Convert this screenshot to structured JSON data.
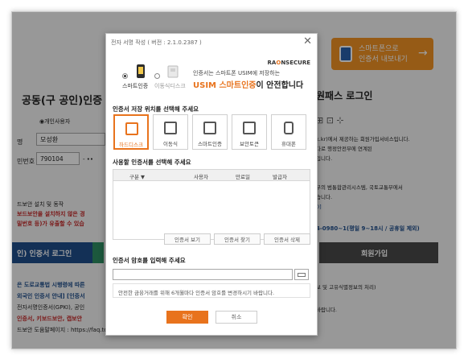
{
  "background": {
    "left": {
      "title": "공동(구 공인)인증",
      "radio_individual": "◉개인사용자",
      "name_label": "명",
      "name_value": "모성환",
      "id_label": "민번호",
      "id_value": "790104",
      "id_dash": "- ••",
      "security_note": "드보안 설치 및 동작",
      "security_line2": "보드보안을 설치하지 않은 경",
      "security_line3": "밀번호 등)가 유출할 수 있습",
      "cert_login": "인) 인증서 로그인",
      "law_line1": "은 도로교통법 시행령에 따른",
      "law_line2": "외국인 인증서 안내] [인증서",
      "law_line3": "전자서명인증서(GPKI), 공인",
      "law_line4": "인증서, 키보드보안, 캡보안",
      "law_line5": "드보안 도움말페이지 : https://faq.touchen.co.kr"
    },
    "right": {
      "phone_line1": "스마트폰으로",
      "phone_line2": "인증서 내보내기",
      "phone_arrow": "→",
      "title": "원패스 로그인",
      "desc1": "k.kr)에서 제공하는 회원가입서비스입니다.",
      "desc2": "다로 행정안전부에 연계된",
      "desc3": "입니다.",
      "desc4": "부의 범통합관리시스템, 국토교통부에서",
      "desc5": "습니다.",
      "link": "0]",
      "phone": "4-0980~1(평일 9~18시 / 공휴일 제외)",
      "join": "회원가입",
      "bottom1": "보 및 고유식별정보의 처리)",
      "bottom2": "바랍니다."
    }
  },
  "dialog": {
    "title": "전자 서명 작성 ( 버전 : 2.1.0.2387 )",
    "close": "✕",
    "mode_smart": "스마트인증",
    "mode_removable": "이동식디스크",
    "promo_small": "인증서는 스마트폰 USIM에 저장하는",
    "promo_big_accent": "USIM 스마트인증",
    "promo_big_rest": "이 안전합니다",
    "raon_a": "RA",
    "raon_o": "O",
    "raon_b": "NSECURE",
    "storage_title": "인증서 저장 위치를 선택해 주세요",
    "locations": [
      "하드디스크",
      "이동식",
      "스마트인증",
      "보안토큰",
      "휴대폰"
    ],
    "select_title": "사용할 인증서를 선택해 주세요",
    "columns": [
      "구분 ▼",
      "사용자",
      "만료일",
      "발급자"
    ],
    "buttons": [
      "인증서 보기",
      "인증서 찾기",
      "인증서 삭제"
    ],
    "password_title": "인증서 암호를 입력해 주세요",
    "notice": "안전한 금융거래를 위해 6개월마다 인증서 암호를 변경하시기 바랍니다.",
    "ok": "확인",
    "cancel": "취소"
  },
  "colors": {
    "accent": "#e8731d",
    "phone_banner": "#f29325",
    "brand_blue": "#2962ad"
  }
}
